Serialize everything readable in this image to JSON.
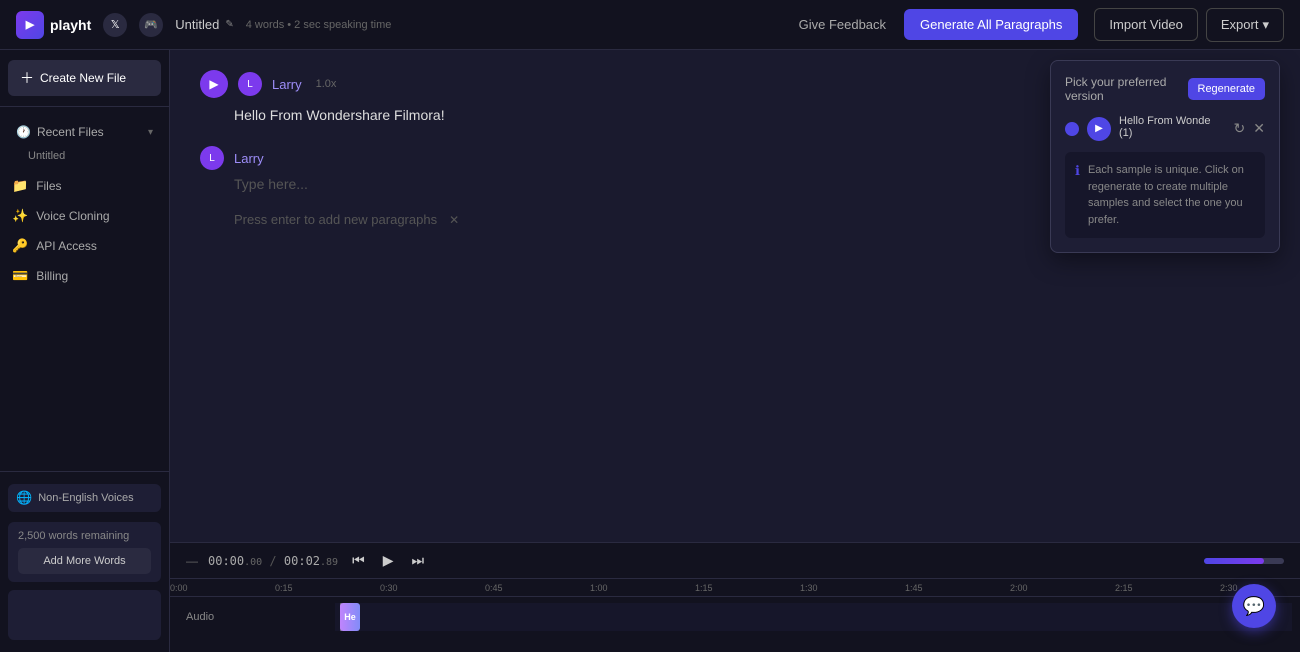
{
  "topbar": {
    "logo_text": "playht",
    "logo_abbr": "▶",
    "file_name": "Untitled",
    "edit_icon": "✎",
    "word_count": "4 words • 2 sec speaking time",
    "feedback_label": "Give Feedback",
    "generate_label": "Generate All Paragraphs",
    "import_label": "Import Video",
    "export_label": "Export",
    "chevron_down": "▾"
  },
  "sidebar": {
    "create_label": "Create New File",
    "recent_section": "Recent Files",
    "recent_files": [
      {
        "name": "Untitled"
      }
    ],
    "nav_items": [
      {
        "id": "files",
        "label": "Files",
        "icon": "📁"
      },
      {
        "id": "voice-cloning",
        "label": "Voice Cloning",
        "icon": "✨"
      },
      {
        "id": "api-access",
        "label": "API Access",
        "icon": "🔑"
      },
      {
        "id": "billing",
        "label": "Billing",
        "icon": "💳"
      }
    ],
    "non_english_label": "Non-English Voices",
    "words_remaining": "2,500 words remaining",
    "add_words_label": "Add More Words"
  },
  "editor": {
    "paragraphs": [
      {
        "voice_name": "Larry",
        "speed": "1.0x",
        "text": "Hello From Wondershare Filmora!",
        "has_play": true
      },
      {
        "voice_name": "Larry",
        "speed": "",
        "text": "",
        "placeholder": "Type here...",
        "has_play": false
      }
    ],
    "add_hint": "Press enter to add new paragraphs"
  },
  "popup": {
    "title": "Pick your preferred version",
    "regenerate_label": "Regenerate",
    "sample_label": "Hello From Wonde (1)",
    "reload_icon": "↻",
    "close_icon": "✕",
    "info_text": "Each sample is unique. Click on regenerate to create multiple samples and select the one you prefer."
  },
  "transport": {
    "dash": "—",
    "time_current": "00:00",
    "ms_current": ".00",
    "separator": "/",
    "time_total": "00:02",
    "ms_total": ".89",
    "skip_back_icon": "⏮",
    "play_icon": "▶",
    "skip_fwd_icon": "⏭"
  },
  "timeline": {
    "ruler_marks": [
      "0:00",
      "0:15",
      "0:30",
      "0:45",
      "1:00",
      "1:15",
      "1:30",
      "1:45",
      "2:00",
      "2:15",
      "2:30"
    ],
    "track_label": "Audio",
    "clip_label": "He"
  }
}
